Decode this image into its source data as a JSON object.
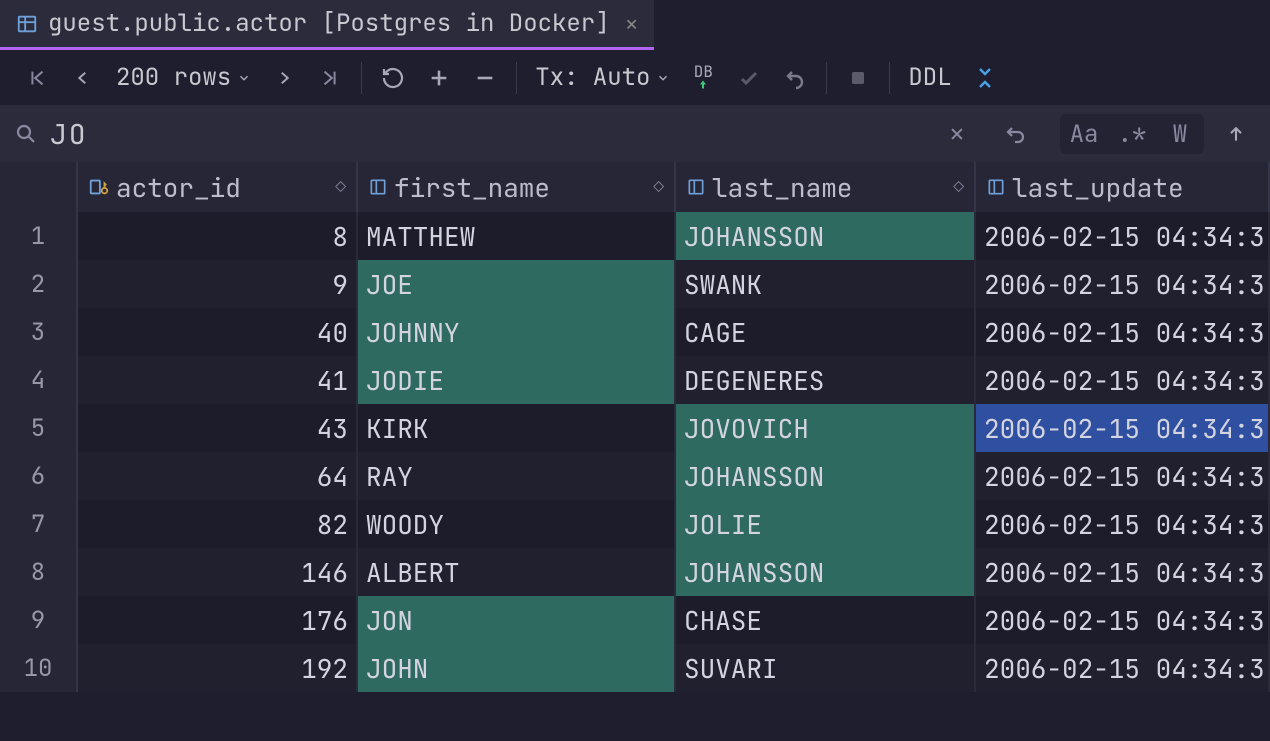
{
  "tab": {
    "title": "guest.public.actor [Postgres in Docker]"
  },
  "toolbar": {
    "rows_label": "200 rows",
    "tx_label": "Tx: Auto",
    "db_label": "DB",
    "ddl_label": "DDL"
  },
  "search": {
    "value": "JO",
    "opt_case": "Aa",
    "opt_regex": ".*",
    "opt_words": "W"
  },
  "columns": [
    {
      "name": "actor_id"
    },
    {
      "name": "first_name"
    },
    {
      "name": "last_name"
    },
    {
      "name": "last_update"
    }
  ],
  "rows": [
    {
      "n": "1",
      "actor_id": "8",
      "first_name": "MATTHEW",
      "last_name": "JOHANSSON",
      "last_update": "2006-02-15 04:34:3",
      "hl_first": false,
      "hl_last": true,
      "sel_last": false
    },
    {
      "n": "2",
      "actor_id": "9",
      "first_name": "JOE",
      "last_name": "SWANK",
      "last_update": "2006-02-15 04:34:3",
      "hl_first": true,
      "hl_last": false,
      "sel_last": false
    },
    {
      "n": "3",
      "actor_id": "40",
      "first_name": "JOHNNY",
      "last_name": "CAGE",
      "last_update": "2006-02-15 04:34:3",
      "hl_first": true,
      "hl_last": false,
      "sel_last": false
    },
    {
      "n": "4",
      "actor_id": "41",
      "first_name": "JODIE",
      "last_name": "DEGENERES",
      "last_update": "2006-02-15 04:34:3",
      "hl_first": true,
      "hl_last": false,
      "sel_last": false
    },
    {
      "n": "5",
      "actor_id": "43",
      "first_name": "KIRK",
      "last_name": "JOVOVICH",
      "last_update": "2006-02-15 04:34:3",
      "hl_first": false,
      "hl_last": true,
      "sel_last": true
    },
    {
      "n": "6",
      "actor_id": "64",
      "first_name": "RAY",
      "last_name": "JOHANSSON",
      "last_update": "2006-02-15 04:34:3",
      "hl_first": false,
      "hl_last": true,
      "sel_last": false
    },
    {
      "n": "7",
      "actor_id": "82",
      "first_name": "WOODY",
      "last_name": "JOLIE",
      "last_update": "2006-02-15 04:34:3",
      "hl_first": false,
      "hl_last": true,
      "sel_last": false
    },
    {
      "n": "8",
      "actor_id": "146",
      "first_name": "ALBERT",
      "last_name": "JOHANSSON",
      "last_update": "2006-02-15 04:34:3",
      "hl_first": false,
      "hl_last": true,
      "sel_last": false
    },
    {
      "n": "9",
      "actor_id": "176",
      "first_name": "JON",
      "last_name": "CHASE",
      "last_update": "2006-02-15 04:34:3",
      "hl_first": true,
      "hl_last": false,
      "sel_last": false
    },
    {
      "n": "10",
      "actor_id": "192",
      "first_name": "JOHN",
      "last_name": "SUVARI",
      "last_update": "2006-02-15 04:34:3",
      "hl_first": true,
      "hl_last": false,
      "sel_last": false
    }
  ]
}
